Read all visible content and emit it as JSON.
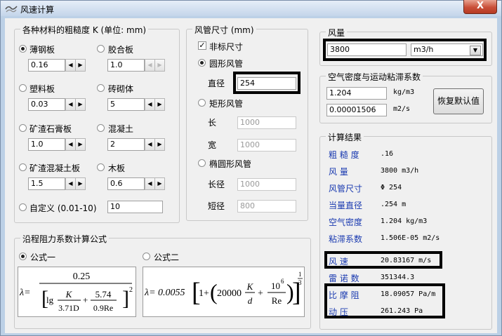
{
  "window": {
    "title": "风速计算",
    "close_label": "X"
  },
  "roughness": {
    "group_label": "各种材料的粗糙度 K  (单位: mm)",
    "items": [
      {
        "label": "薄钢板",
        "value": "0.16",
        "selected": true
      },
      {
        "label": "胶合板",
        "value": "1.0"
      },
      {
        "label": "塑料板",
        "value": "0.03"
      },
      {
        "label": "砖砌体",
        "value": "5"
      },
      {
        "label": "矿渣石膏板",
        "value": "1.0"
      },
      {
        "label": "混凝土",
        "value": "2"
      },
      {
        "label": "矿渣混凝土板",
        "value": "1.5"
      },
      {
        "label": "木板",
        "value": "0.6"
      }
    ],
    "custom_label": "自定义 (0.01-10)",
    "custom_value": "10"
  },
  "duct": {
    "group_label": "风管尺寸 (mm)",
    "nonstandard_label": "非标尺寸",
    "nonstandard_checked": true,
    "round_label": "圆形风管",
    "diameter_label": "直径",
    "diameter_value": "254",
    "rect_label": "矩形风管",
    "length_label": "长",
    "length_value": "1000",
    "width_label": "宽",
    "width_value": "1000",
    "ellipse_label": "椭圆形风管",
    "long_axis_label": "长径",
    "long_axis_value": "1000",
    "short_axis_label": "短径",
    "short_axis_value": "800"
  },
  "airflow": {
    "group_label": "风量",
    "value": "3800",
    "unit": "m3/h"
  },
  "air": {
    "group_label": "空气密度与运动粘滞系数",
    "density_value": "1.204",
    "density_unit": "kg/m3",
    "viscosity_value": "0.00001506",
    "viscosity_unit": "m2/s",
    "reset_label": "恢复默认值"
  },
  "results": {
    "group_label": "计算结果",
    "rows": [
      {
        "label": "粗 糙 度",
        "value": ".16"
      },
      {
        "label": "风    量",
        "value": "3800 m3/h"
      },
      {
        "label": "风管尺寸",
        "value": "Φ 254"
      },
      {
        "label": "当量直径",
        "value": ".254 m"
      },
      {
        "label": "空气密度",
        "value": "1.204 kg/m3"
      },
      {
        "label": "粘滞系数",
        "value": "1.506E-05 m2/s"
      },
      {
        "label": "风    速",
        "value": "20.83167 m/s"
      },
      {
        "label": "雷 诺 数",
        "value": "351344.3"
      },
      {
        "label": "比 摩 阻",
        "value": "18.09057 Pa/m"
      },
      {
        "label": "动    压",
        "value": "261.243 Pa"
      }
    ]
  },
  "friction": {
    "group_label": "沿程阻力系数计算公式",
    "formula1_label": "公式一",
    "formula1_selected": true,
    "formula2_label": "公式二",
    "formula1": {
      "lambda": "λ=",
      "num": "0.25",
      "lg": "lg",
      "k": "K",
      "d1": "3.71D",
      "n2": "5.74",
      "d2": "0.9Re",
      "exp": "2",
      "plus": "+"
    },
    "formula2": {
      "lead": "λ= 0.0055",
      "one": "1+",
      "c": "20000",
      "k": "K",
      "d": "d",
      "plus": "+",
      "ten": "10",
      "six": "6",
      "re": "Re",
      "exp_n": "1",
      "exp_d": "3"
    }
  },
  "icons": [
    "app-icon",
    "close-icon",
    "spin-left-icon",
    "spin-right-icon",
    "dropdown-arrow-icon",
    "radio-icon",
    "checkbox-icon"
  ]
}
